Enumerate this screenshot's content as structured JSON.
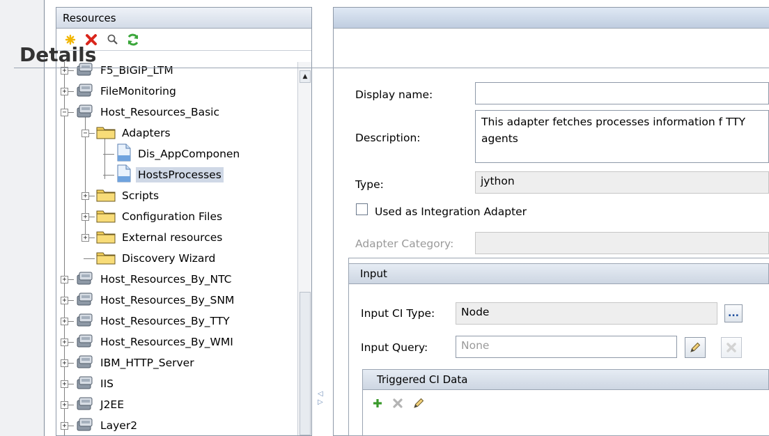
{
  "resources_panel": {
    "title": "Resources",
    "toolbar": [
      "new-icon",
      "delete-icon",
      "find-icon",
      "refresh-icon"
    ],
    "tree": [
      {
        "label": "F5_BIGIP_LTM",
        "kind": "package",
        "expanded": false
      },
      {
        "label": "FileMonitoring",
        "kind": "package",
        "expanded": false
      },
      {
        "label": "Host_Resources_Basic",
        "kind": "package",
        "expanded": true
      },
      {
        "label": "Adapters",
        "kind": "folder",
        "expanded": true
      },
      {
        "label": "Dis_AppComponen",
        "kind": "file"
      },
      {
        "label": "HostsProcesses",
        "kind": "file",
        "selected": true
      },
      {
        "label": "Scripts",
        "kind": "folder",
        "expanded": false
      },
      {
        "label": "Configuration Files",
        "kind": "folder",
        "expanded": false
      },
      {
        "label": "External resources",
        "kind": "folder",
        "expanded": false
      },
      {
        "label": "Discovery Wizard",
        "kind": "folder"
      },
      {
        "label": "Host_Resources_By_NTC",
        "kind": "package",
        "expanded": false
      },
      {
        "label": "Host_Resources_By_SNM",
        "kind": "package",
        "expanded": false
      },
      {
        "label": "Host_Resources_By_TTY",
        "kind": "package",
        "expanded": false
      },
      {
        "label": "Host_Resources_By_WMI",
        "kind": "package",
        "expanded": false
      },
      {
        "label": "IBM_HTTP_Server",
        "kind": "package",
        "expanded": false
      },
      {
        "label": "IIS",
        "kind": "package",
        "expanded": false
      },
      {
        "label": "J2EE",
        "kind": "package",
        "expanded": false
      },
      {
        "label": "Layer2",
        "kind": "package",
        "expanded": false
      }
    ]
  },
  "details": {
    "title": "Details",
    "display_name_label": "Display name:",
    "display_name_value": "",
    "description_label": "Description:",
    "description_value": "This adapter fetches processes information f TTY agents",
    "type_label": "Type:",
    "type_value": "jython",
    "integration_checkbox_label": "Used as Integration Adapter",
    "integration_checked": false,
    "adapter_category_label": "Adapter Category:",
    "adapter_category_value": ""
  },
  "input_section": {
    "title": "Input",
    "ci_type_label": "Input CI Type:",
    "ci_type_value": "Node",
    "ci_type_button": "...",
    "query_label": "Input Query:",
    "query_placeholder": "None",
    "triggered_title": "Triggered CI Data"
  },
  "colors": {
    "panel_header": "#d3dbe7",
    "selection": "#cfd8e6",
    "delete_red": "#d9261c",
    "add_green": "#3a9a2b",
    "refresh_green": "#3aa63a",
    "new_yellow": "#f2b600"
  }
}
